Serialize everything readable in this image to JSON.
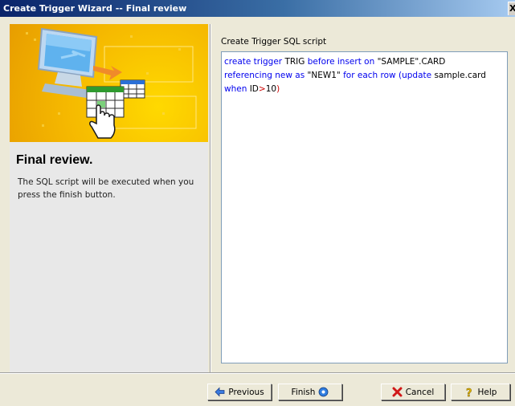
{
  "window": {
    "title": "Create Trigger Wizard -- Final review",
    "close_glyph": "X"
  },
  "left": {
    "heading": "Final review.",
    "description": "The SQL script will be executed when you press the finish button."
  },
  "right": {
    "caption": "Create Trigger SQL script",
    "sql_tokens": [
      [
        {
          "t": "create trigger ",
          "c": "kw"
        },
        {
          "t": "TRIG ",
          "c": "str"
        },
        {
          "t": "before insert on ",
          "c": "kw"
        },
        {
          "t": "\"SAMPLE\".CARD",
          "c": "str"
        }
      ],
      [
        {
          "t": "referencing new as ",
          "c": "kw"
        },
        {
          "t": "\"NEW1\" ",
          "c": "str"
        },
        {
          "t": "for each row ",
          "c": "kw"
        },
        {
          "t": "(",
          "c": "kw"
        },
        {
          "t": "update ",
          "c": "kw"
        },
        {
          "t": "sample.card",
          "c": "str"
        }
      ],
      [
        {
          "t": "when ",
          "c": "kw"
        },
        {
          "t": "ID",
          "c": "str"
        },
        {
          "t": ">",
          "c": "op"
        },
        {
          "t": "10",
          "c": "str"
        },
        {
          "t": ")",
          "c": "op"
        }
      ]
    ]
  },
  "buttons": {
    "previous": {
      "label": "Previous",
      "icon": "arrow-left-icon"
    },
    "finish": {
      "label": "Finish",
      "icon": "finish-circle-icon"
    },
    "cancel": {
      "label": "Cancel",
      "icon": "cancel-x-icon"
    },
    "help": {
      "label": "Help",
      "icon": "question-mark-icon"
    }
  },
  "colors": {
    "keyword": "#0000ee",
    "operator": "#cc0000",
    "banner": "#f5b800"
  }
}
